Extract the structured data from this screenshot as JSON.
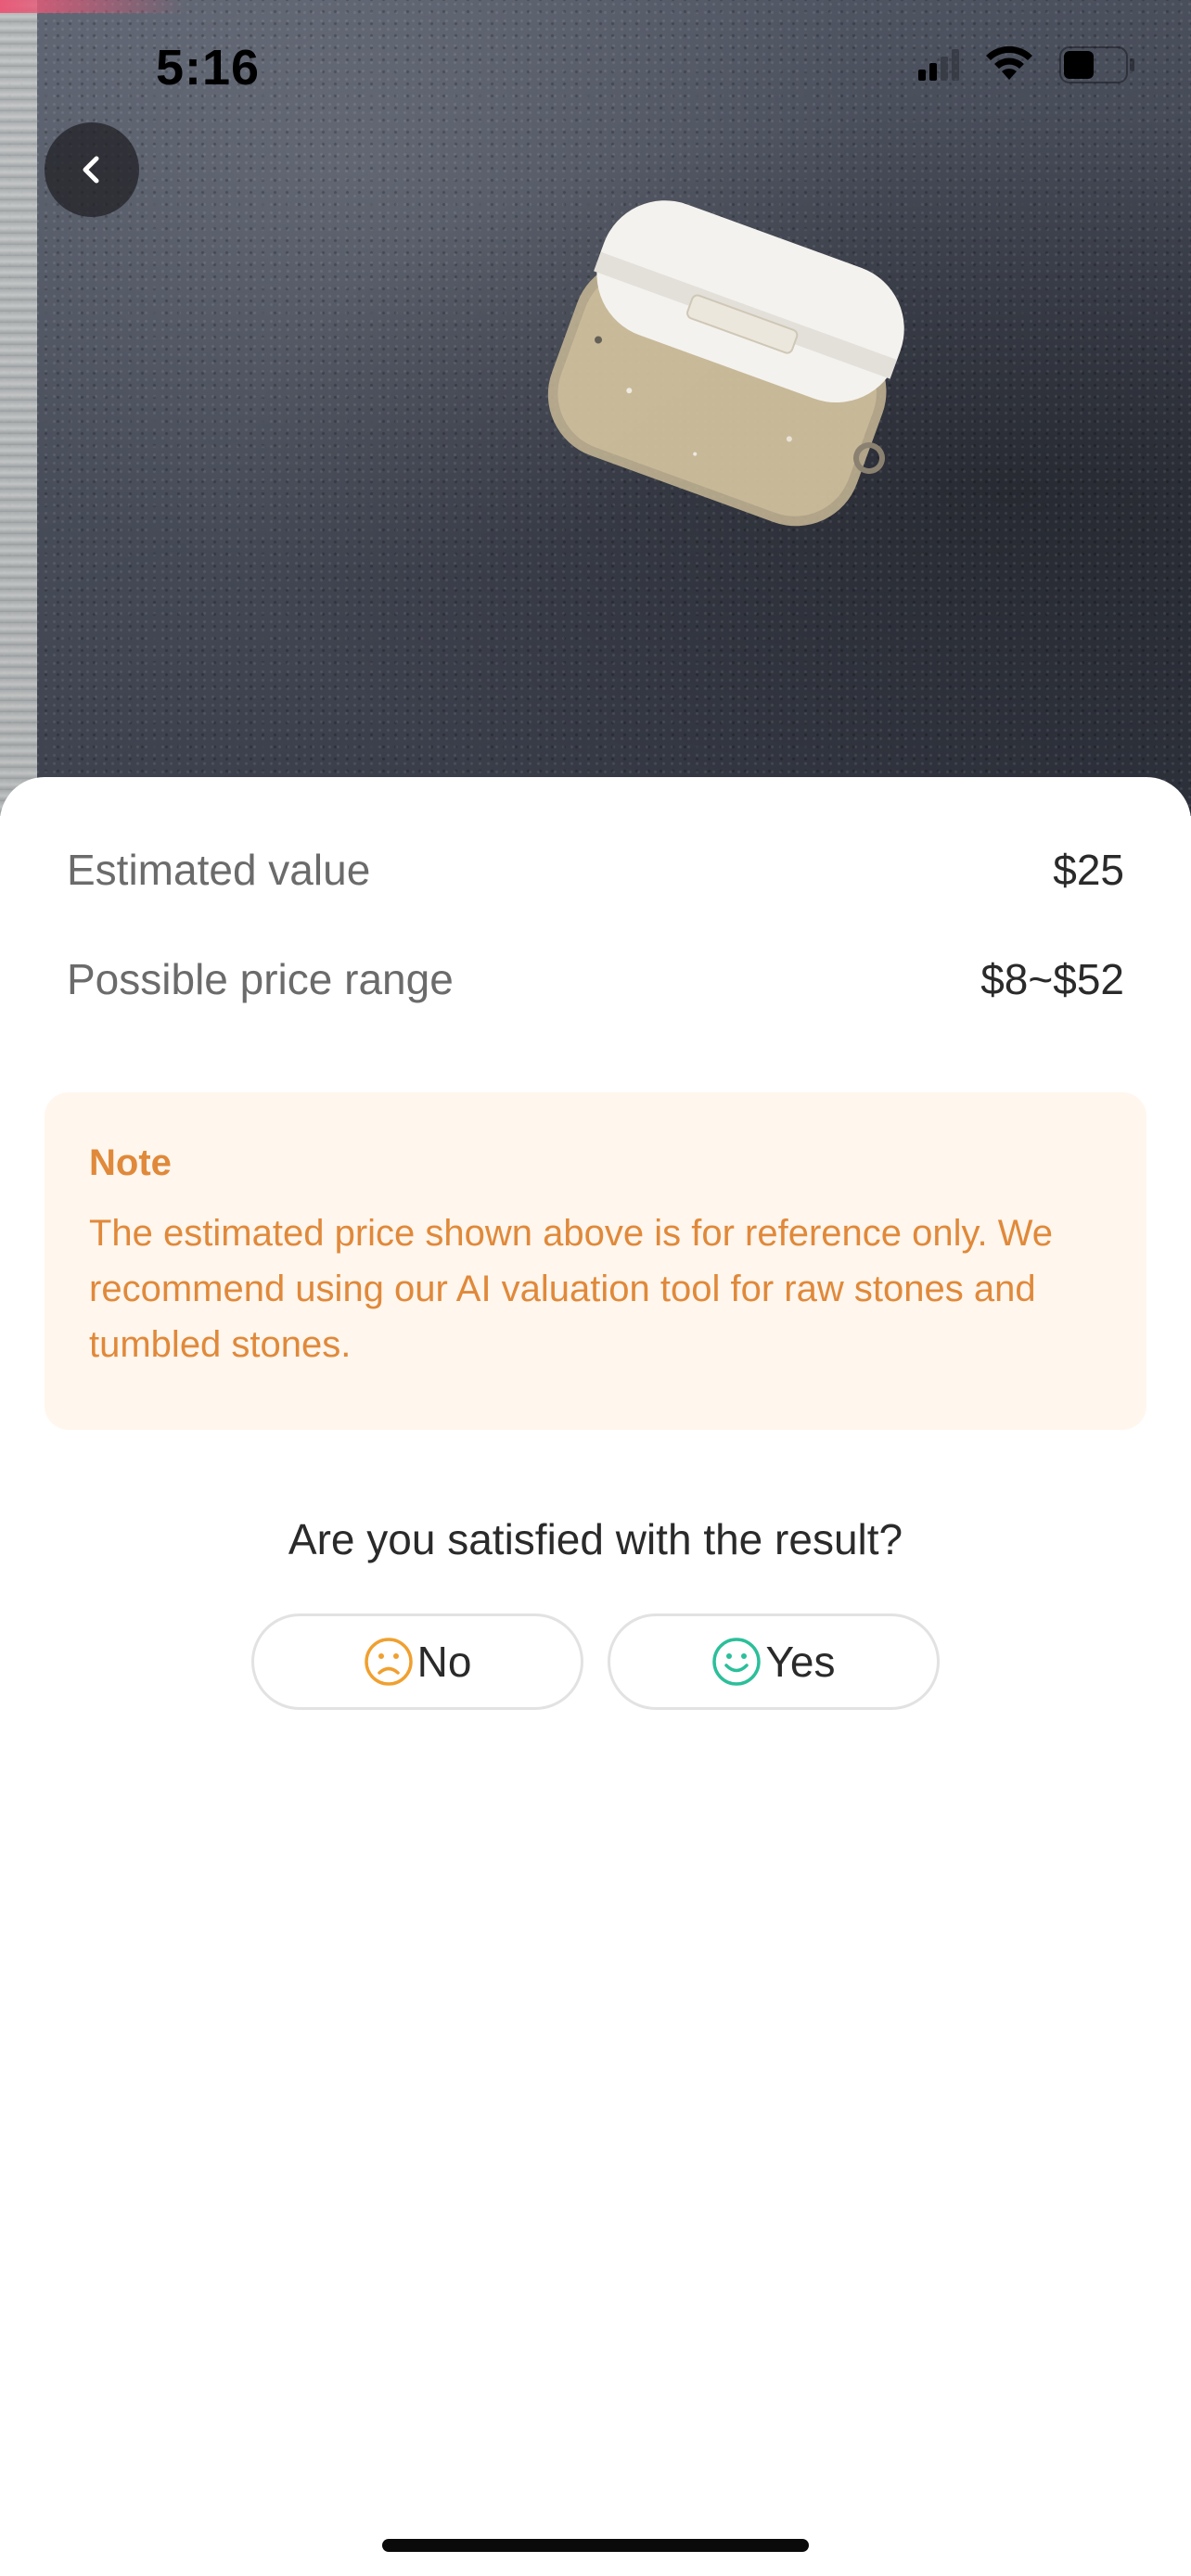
{
  "status_bar": {
    "time": "5:16",
    "icons": [
      "cellular-signal-icon",
      "wifi-icon",
      "battery-icon"
    ]
  },
  "header": {
    "back_icon": "chevron-left-icon"
  },
  "results": {
    "estimated_value_label": "Estimated value",
    "estimated_value": "$25",
    "price_range_label": "Possible price range",
    "price_range": "$8~$52"
  },
  "note": {
    "title": "Note",
    "body": "The estimated price shown above is for reference only. We recommend using our AI valuation tool for raw stones and tumbled stones."
  },
  "feedback": {
    "question": "Are you satisfied with the result?",
    "no_label": "No",
    "no_icon": "sad-face-icon",
    "yes_label": "Yes",
    "yes_icon": "smiley-face-icon"
  },
  "colors": {
    "note_accent": "#e0893a",
    "note_background": "#fff6ed",
    "no_icon_color": "#f0a030",
    "yes_icon_color": "#2bbf9a"
  }
}
